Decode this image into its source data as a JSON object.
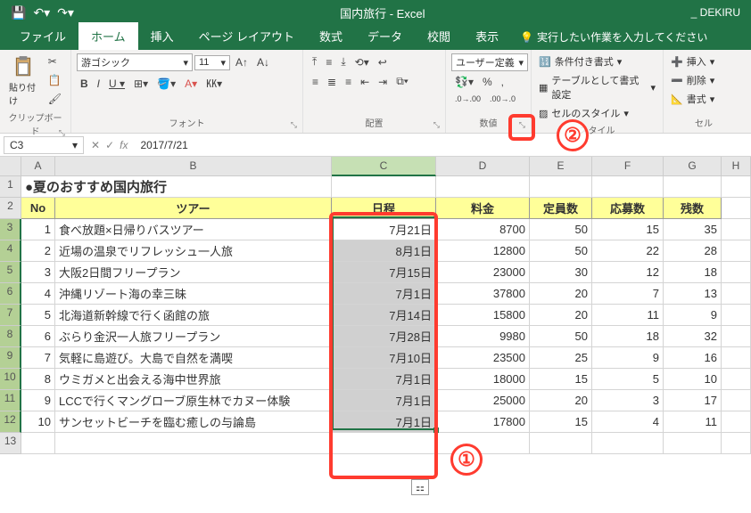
{
  "window": {
    "title": "国内旅行  -  Excel",
    "user": "_ DEKIRU"
  },
  "tabs": {
    "file": "ファイル",
    "home": "ホーム",
    "insert": "挿入",
    "pageLayout": "ページ レイアウト",
    "formulas": "数式",
    "data": "データ",
    "review": "校閲",
    "view": "表示",
    "tellMe": "実行したい作業を入力してください"
  },
  "ribbon": {
    "clipboard": {
      "paste": "貼り付け",
      "label": "クリップボード"
    },
    "font": {
      "name": "游ゴシック",
      "size": "11",
      "label": "フォント"
    },
    "align": {
      "label": "配置"
    },
    "number": {
      "format": "ユーザー定義",
      "label": "数値"
    },
    "styles": {
      "condFmt": "条件付き書式",
      "table": "テーブルとして書式設定",
      "cellStyles": "セルのスタイル",
      "label": "スタイル"
    },
    "cells": {
      "insert": "挿入",
      "delete": "削除",
      "format": "書式",
      "label": "セル"
    }
  },
  "formulaBar": {
    "ref": "C3",
    "value": "2017/7/21"
  },
  "columns": [
    "A",
    "B",
    "C",
    "D",
    "E",
    "F",
    "G",
    "H"
  ],
  "sheetTitle": "●夏のおすすめ国内旅行",
  "headers": {
    "no": "No",
    "tour": "ツアー",
    "date": "日程",
    "price": "料金",
    "capacity": "定員数",
    "applicants": "応募数",
    "remaining": "残数"
  },
  "rows": [
    {
      "no": 1,
      "tour": "食べ放題×日帰りバスツアー",
      "date": "7月21日",
      "price": 8700,
      "capacity": 50,
      "applicants": 15,
      "remaining": 35
    },
    {
      "no": 2,
      "tour": "近場の温泉でリフレッシュ一人旅",
      "date": "8月1日",
      "price": 12800,
      "capacity": 50,
      "applicants": 22,
      "remaining": 28
    },
    {
      "no": 3,
      "tour": "大阪2日間フリープラン",
      "date": "7月15日",
      "price": 23000,
      "capacity": 30,
      "applicants": 12,
      "remaining": 18
    },
    {
      "no": 4,
      "tour": "沖縄リゾート海の幸三昧",
      "date": "7月1日",
      "price": 37800,
      "capacity": 20,
      "applicants": 7,
      "remaining": 13
    },
    {
      "no": 5,
      "tour": "北海道新幹線で行く函館の旅",
      "date": "7月14日",
      "price": 15800,
      "capacity": 20,
      "applicants": 11,
      "remaining": 9
    },
    {
      "no": 6,
      "tour": "ぶらり金沢一人旅フリープラン",
      "date": "7月28日",
      "price": 9980,
      "capacity": 50,
      "applicants": 18,
      "remaining": 32
    },
    {
      "no": 7,
      "tour": "気軽に島遊び。大島で自然を満喫",
      "date": "7月10日",
      "price": 23500,
      "capacity": 25,
      "applicants": 9,
      "remaining": 16
    },
    {
      "no": 8,
      "tour": "ウミガメと出会える海中世界旅",
      "date": "7月1日",
      "price": 18000,
      "capacity": 15,
      "applicants": 5,
      "remaining": 10
    },
    {
      "no": 9,
      "tour": "LCCで行くマングローブ原生林でカヌー体験",
      "date": "7月1日",
      "price": 25000,
      "capacity": 20,
      "applicants": 3,
      "remaining": 17
    },
    {
      "no": 10,
      "tour": "サンセットビーチを臨む癒しの与論島",
      "date": "7月1日",
      "price": 17800,
      "capacity": 15,
      "applicants": 4,
      "remaining": 11
    }
  ],
  "annotations": {
    "one": "①",
    "two": "②"
  }
}
